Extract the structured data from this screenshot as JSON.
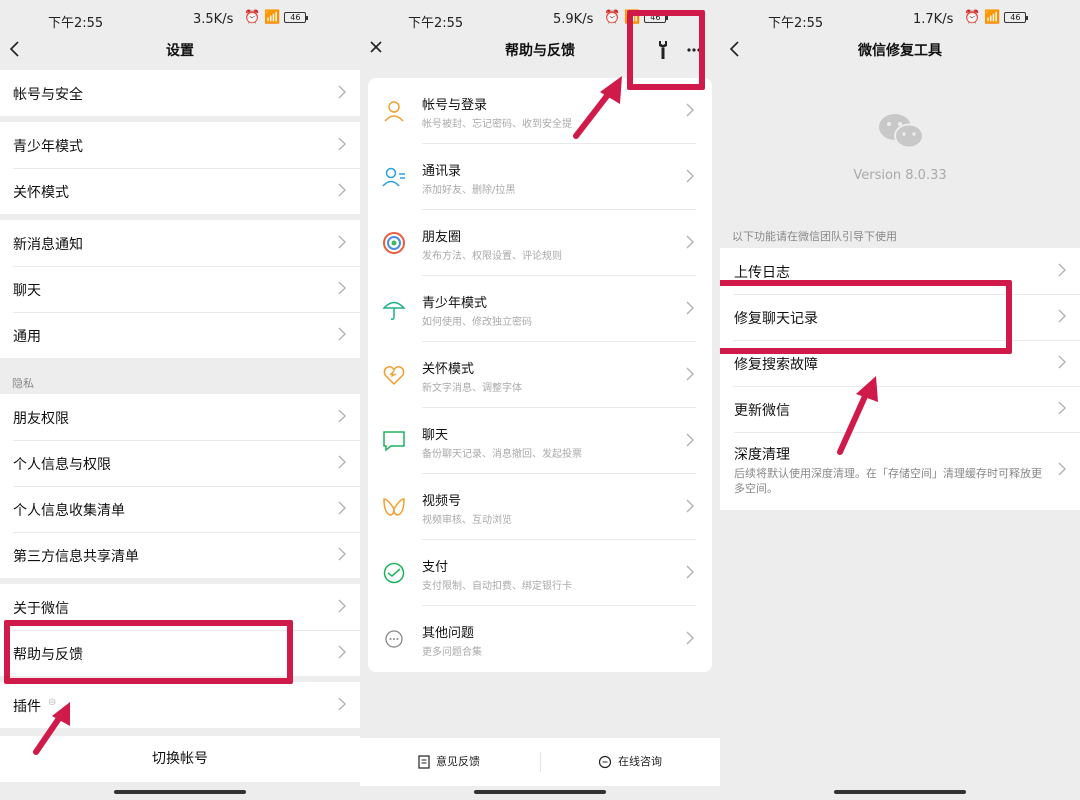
{
  "status_bars": [
    {
      "time": "下午2:55",
      "speed": "3.5K/s",
      "battery": "46"
    },
    {
      "time": "下午2:55",
      "speed": "5.9K/s",
      "battery": "46"
    },
    {
      "time": "下午2:55",
      "speed": "1.7K/s",
      "battery": "46"
    }
  ],
  "settings": {
    "title": "设置",
    "groups": [
      [
        "帐号与安全"
      ],
      [
        "青少年模式",
        "关怀模式"
      ],
      [
        "新消息通知",
        "聊天",
        "通用"
      ],
      [
        "朋友权限",
        "个人信息与权限",
        "个人信息收集清单",
        "第三方信息共享清单"
      ],
      [
        "关于微信",
        "帮助与反馈"
      ],
      [
        "插件"
      ]
    ],
    "privacy_label": "隐私",
    "switch_account": "切换帐号"
  },
  "help": {
    "title": "帮助与反馈",
    "items": [
      {
        "title": "帐号与登录",
        "subtitle": "帐号被封、忘记密码、收到安全提"
      },
      {
        "title": "通讯录",
        "subtitle": "添加好友、删除/拉黑"
      },
      {
        "title": "朋友圈",
        "subtitle": "发布方法、权限设置、评论规则"
      },
      {
        "title": "青少年模式",
        "subtitle": "如何使用、修改独立密码"
      },
      {
        "title": "关怀模式",
        "subtitle": "新文字消息、调整字体"
      },
      {
        "title": "聊天",
        "subtitle": "备份聊天记录、消息撤回、发起投票"
      },
      {
        "title": "视频号",
        "subtitle": "视频审核、互动浏览"
      },
      {
        "title": "支付",
        "subtitle": "支付限制、自动扣费、绑定银行卡"
      },
      {
        "title": "其他问题",
        "subtitle": "更多问题合集"
      }
    ],
    "feedback": "意见反馈",
    "consult": "在线咨询"
  },
  "repair": {
    "title": "微信修复工具",
    "version": "Version 8.0.33",
    "hint": "以下功能请在微信团队引导下使用",
    "items": [
      "上传日志",
      "修复聊天记录",
      "修复搜索故障",
      "更新微信"
    ],
    "deep_title": "深度清理",
    "deep_desc": "后续将默认使用深度清理。在「存储空间」清理缓存时可释放更多空间。"
  },
  "colors": {
    "highlight": "#d01a4a",
    "wechat_gray": "#c8c8c8"
  }
}
